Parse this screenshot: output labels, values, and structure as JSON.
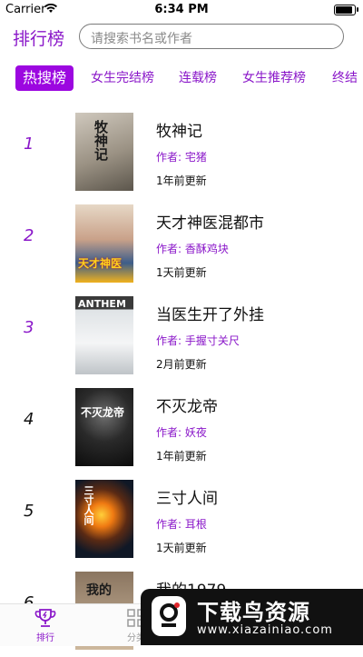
{
  "status": {
    "carrier": "Carrier",
    "time": "6:34 PM",
    "battery_level": 1.0
  },
  "header": {
    "title": "排行榜",
    "search_placeholder": "请搜索书名或作者"
  },
  "tabs": [
    {
      "label": "热搜榜",
      "active": true
    },
    {
      "label": "女生完结榜",
      "active": false
    },
    {
      "label": "连载榜",
      "active": false
    },
    {
      "label": "女生推荐榜",
      "active": false
    },
    {
      "label": "终结",
      "active": false
    }
  ],
  "books": [
    {
      "rank": "1",
      "title": "牧神记",
      "author": "作者: 宅猪",
      "updated": "1年前更新",
      "cover_text": "牧神记"
    },
    {
      "rank": "2",
      "title": "天才神医混都市",
      "author": "作者: 香酥鸡块",
      "updated": "1天前更新",
      "cover_text": "天才神医"
    },
    {
      "rank": "3",
      "title": "当医生开了外挂",
      "author": "作者: 手握寸关尺",
      "updated": "2月前更新",
      "cover_text": "ANTHEM"
    },
    {
      "rank": "4",
      "title": "不灭龙帝",
      "author": "作者: 妖夜",
      "updated": "1年前更新",
      "cover_text": "不灭龙帝"
    },
    {
      "rank": "5",
      "title": "三寸人间",
      "author": "作者: 耳根",
      "updated": "1天前更新",
      "cover_text": "三寸人间"
    },
    {
      "rank": "6",
      "title": "我的1979",
      "author": "",
      "updated": "",
      "cover_text": "我的"
    }
  ],
  "tabbar": [
    {
      "label": "排行",
      "icon": "trophy-icon",
      "active": true
    },
    {
      "label": "分类",
      "icon": "grid-icon",
      "active": false
    }
  ],
  "watermark": {
    "title": "下载鸟资源",
    "url": "www.xiazainiao.com"
  },
  "colors": {
    "accent": "#8a17c9",
    "active_tab_bg": "#9c07e0"
  }
}
